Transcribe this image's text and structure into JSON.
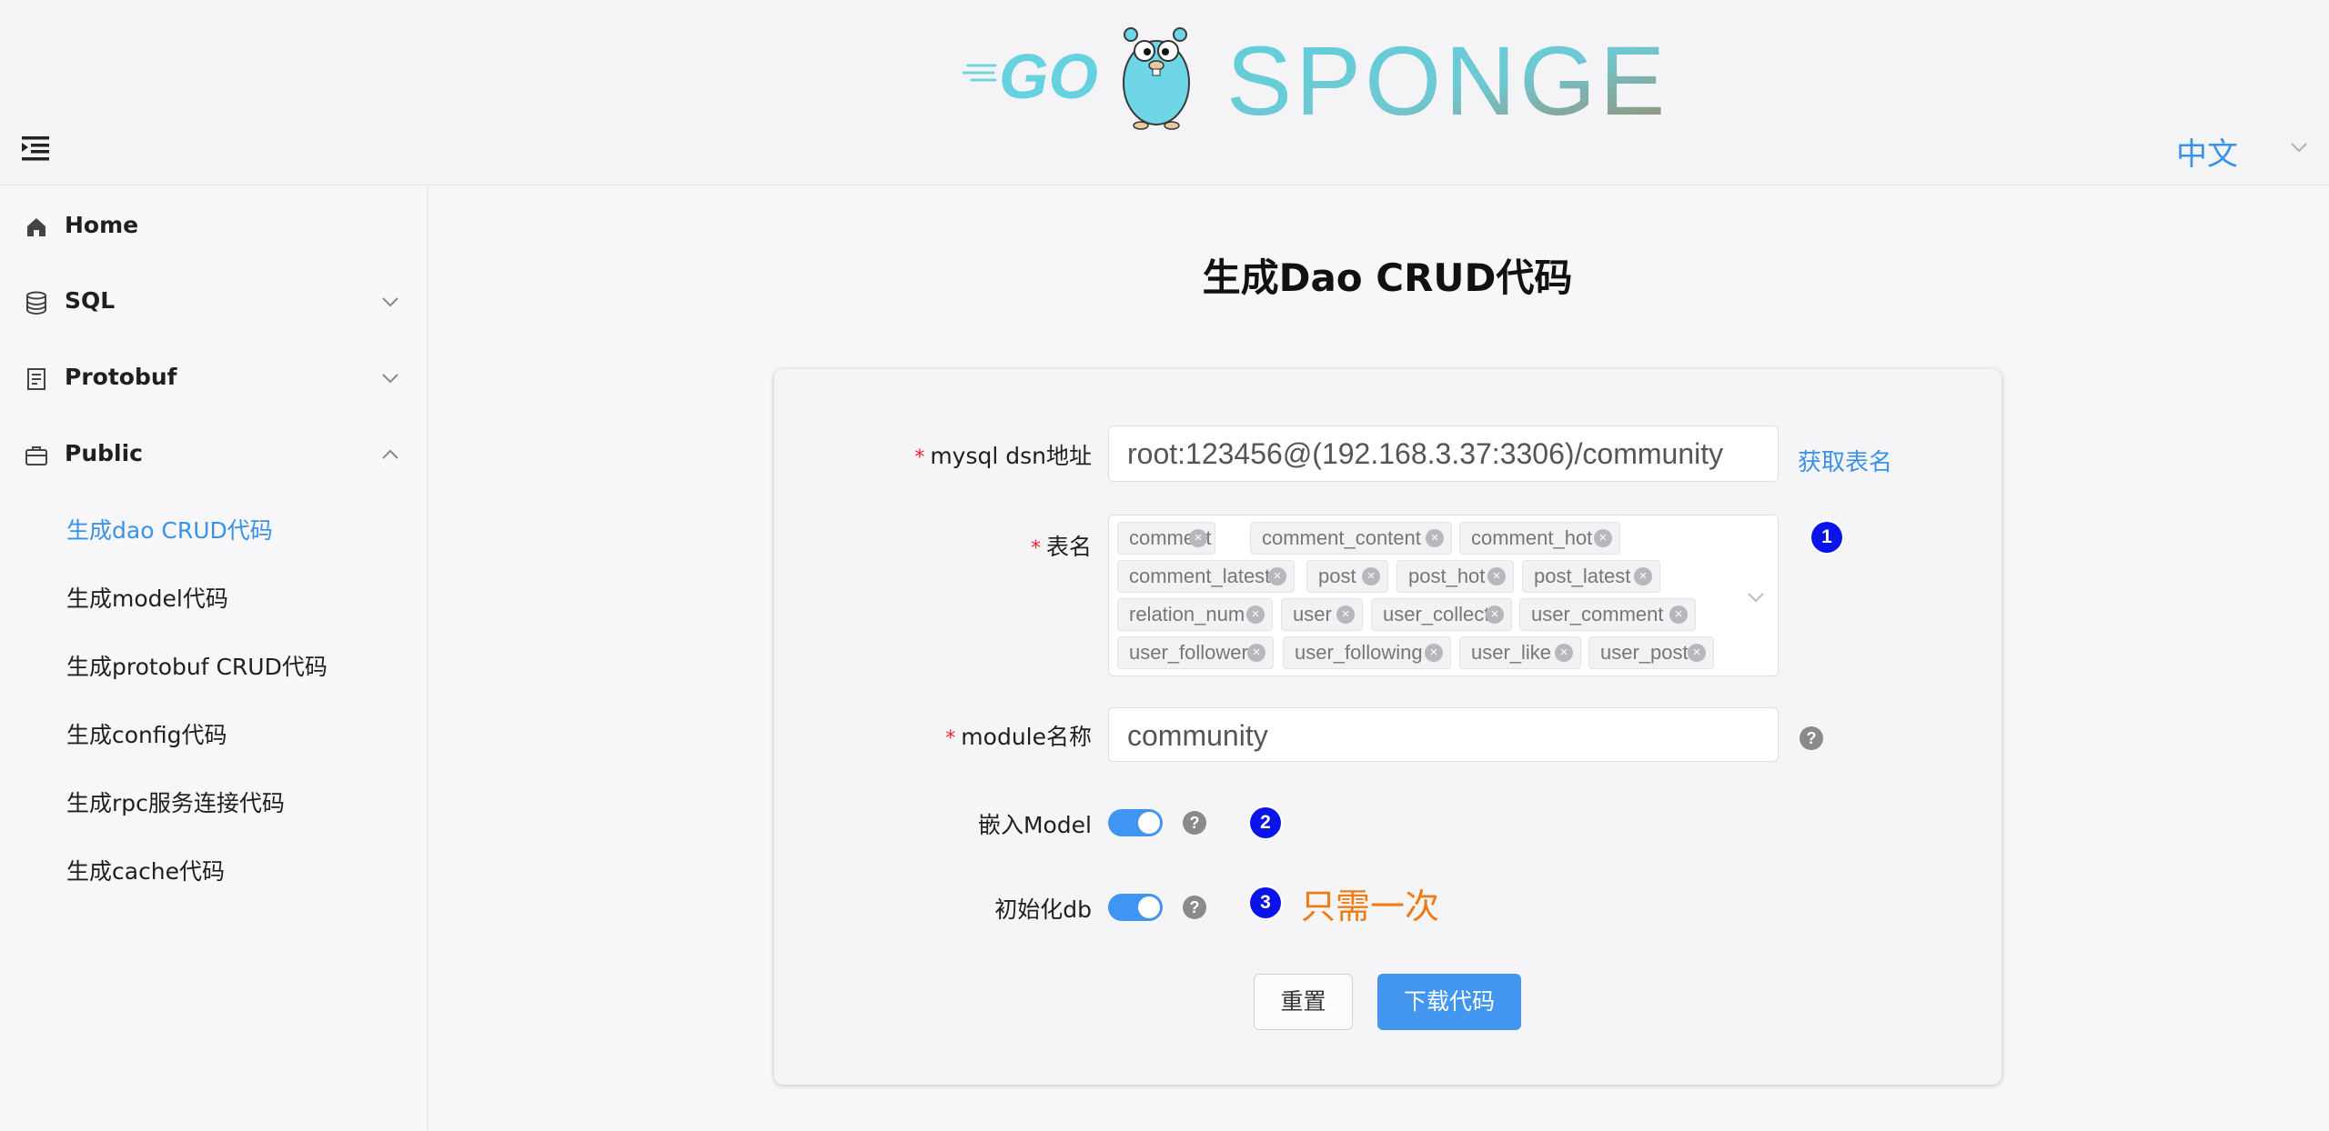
{
  "header": {
    "logo_text": "GO SPONGE",
    "language": "中文"
  },
  "sidebar": {
    "items": [
      {
        "label": "Home",
        "icon": "home-icon"
      },
      {
        "label": "SQL",
        "icon": "database-icon"
      },
      {
        "label": "Protobuf",
        "icon": "document-icon"
      },
      {
        "label": "Public",
        "icon": "briefcase-icon"
      }
    ],
    "sub_items": [
      {
        "label": "生成dao CRUD代码",
        "active": true
      },
      {
        "label": "生成model代码"
      },
      {
        "label": "生成protobuf CRUD代码"
      },
      {
        "label": "生成config代码"
      },
      {
        "label": "生成rpc服务连接代码"
      },
      {
        "label": "生成cache代码"
      }
    ]
  },
  "page": {
    "title": "生成Dao CRUD代码"
  },
  "form": {
    "dsn_label": "mysql dsn地址",
    "dsn_value": "root:123456@(192.168.3.37:3306)/community",
    "fetch_tables_link": "获取表名",
    "tables_label": "表名",
    "tables": [
      "comment",
      "comment_content",
      "comment_hot",
      "comment_latest",
      "post",
      "post_hot",
      "post_latest",
      "relation_num",
      "user",
      "user_collect",
      "user_comment",
      "user_follower",
      "user_following",
      "user_like",
      "user_post"
    ],
    "module_label": "module名称",
    "module_value": "community",
    "embed_label": "嵌入Model",
    "embed_on": true,
    "init_db_label": "初始化db",
    "init_db_on": true,
    "badges": [
      "1",
      "2",
      "3"
    ],
    "note": "只需一次",
    "help_glyph": "?",
    "reset_button": "重置",
    "download_button": "下载代码"
  },
  "colors": {
    "accent": "#3a92e8",
    "primary_button": "#4396f0",
    "badge": "#0a14e8",
    "note": "#f07a14",
    "required": "#f5222d"
  }
}
